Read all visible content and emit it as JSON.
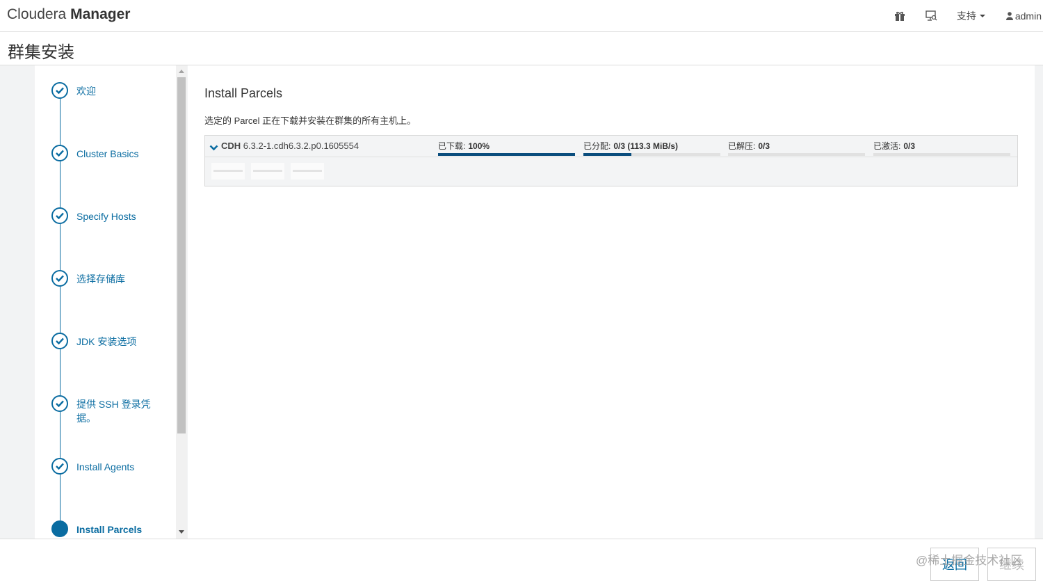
{
  "navbar": {
    "brand_light": "Cloudera",
    "brand_bold": "Manager",
    "support_label": "支持",
    "user_label": "admin"
  },
  "page": {
    "title": "群集安装"
  },
  "wizard": {
    "steps": [
      {
        "label": "欢迎",
        "state": "done"
      },
      {
        "label": "Cluster Basics",
        "state": "done"
      },
      {
        "label": "Specify Hosts",
        "state": "done"
      },
      {
        "label": "选择存储库",
        "state": "done"
      },
      {
        "label": "JDK 安装选项",
        "state": "done"
      },
      {
        "label": "提供 SSH 登录凭据。",
        "state": "done"
      },
      {
        "label": "Install Agents",
        "state": "done"
      },
      {
        "label": "Install Parcels",
        "state": "active"
      }
    ]
  },
  "content": {
    "title": "Install Parcels",
    "description": "选定的 Parcel 正在下载并安装在群集的所有主机上。",
    "parcel": {
      "name": "CDH",
      "version": "6.3.2-1.cdh6.3.2.p0.1605554",
      "stats": [
        {
          "label": "已下载:",
          "value": "100%",
          "progress": 1.0
        },
        {
          "label": "已分配:",
          "value": "0/3 (113.3 MiB/s)",
          "progress": 0.35
        },
        {
          "label": "已解压:",
          "value": "0/3",
          "progress": 0
        },
        {
          "label": "已激活:",
          "value": "0/3",
          "progress": 0
        }
      ]
    }
  },
  "footer": {
    "back_label": "返回",
    "next_label": "继续",
    "watermark": "@稀土掘金技术社区"
  },
  "colors": {
    "accent": "#0a6ca1",
    "progress": "#0a4d7d"
  }
}
